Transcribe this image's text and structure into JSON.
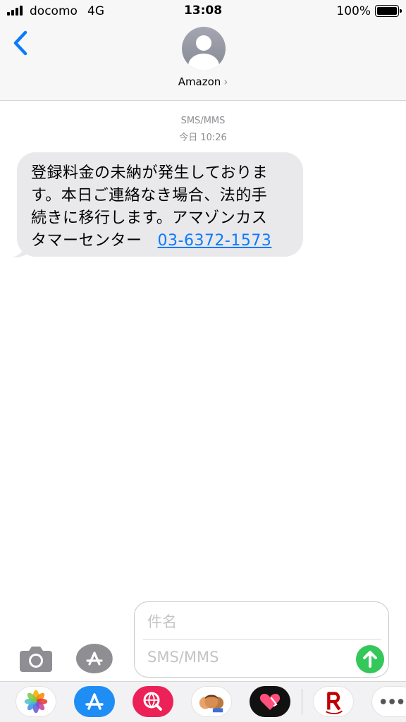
{
  "status_bar": {
    "carrier": "docomo",
    "network": "4G",
    "time": "13:08",
    "battery": "100%"
  },
  "header": {
    "contact_name": "Amazon",
    "back_icon": "chevron-left-icon",
    "avatar_icon": "person-icon"
  },
  "conversation": {
    "service": "SMS/MMS",
    "timestamp": "今日 10:26",
    "message": {
      "lines": [
        "登録料金の未納が発生しておりま",
        "す。本日ご連絡なき場合、法的手",
        "続きに移行します。アマゾンカス",
        "タマーセンター"
      ],
      "phone_link": "03-6372-1573"
    }
  },
  "compose": {
    "subject_placeholder": "件名",
    "message_placeholder": "SMS/MMS",
    "camera_icon": "camera-icon",
    "apps_icon": "app-store-icon",
    "send_icon": "arrow-up-icon"
  },
  "app_drawer": {
    "apps": [
      "photos-icon",
      "app-store-icon",
      "web-search-icon",
      "memoji-icon",
      "digital-touch-icon",
      "rakuten-icon",
      "more-icon"
    ]
  },
  "colors": {
    "accent": "#0a7aff",
    "bubble": "#e9e9eb",
    "send": "#34c759",
    "header_bg": "#f7f7f7"
  }
}
